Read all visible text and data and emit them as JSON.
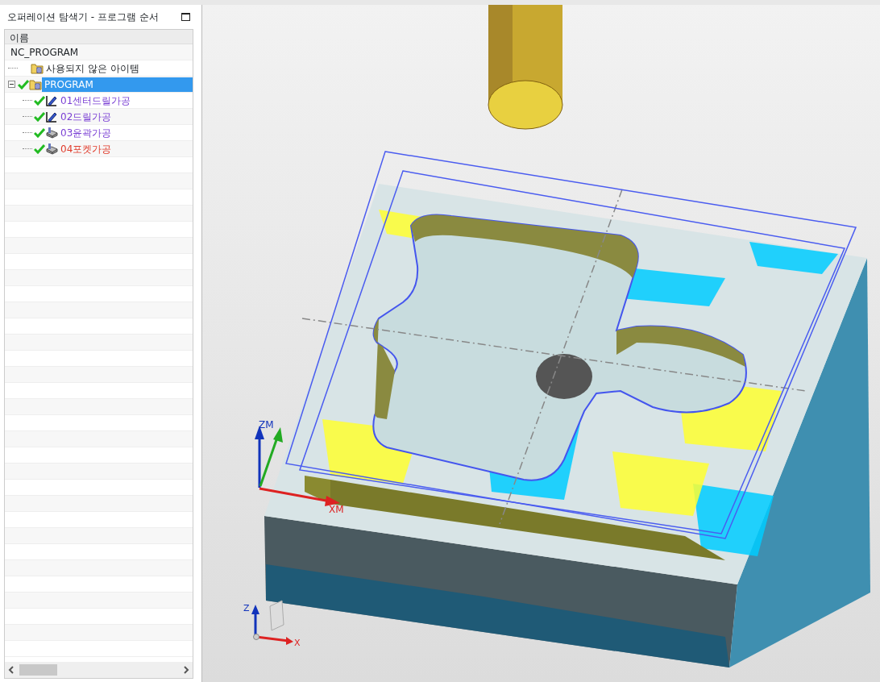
{
  "panel": {
    "title": "오퍼레이션 탐색기 - 프로그램 순서",
    "column": "이름"
  },
  "tree": {
    "label": "NC_PROGRAM",
    "children": [
      {
        "label": "사용되지 않은 아이템",
        "kind": "folder",
        "done": false,
        "selected": false
      },
      {
        "label": "PROGRAM",
        "kind": "folder",
        "done": true,
        "selected": true,
        "expanded": true,
        "children": [
          {
            "label": "01센터드릴가공",
            "kind": "drill",
            "done": true,
            "selected": false,
            "color": "#7a3fd4"
          },
          {
            "label": "02드릴가공",
            "kind": "drill",
            "done": true,
            "selected": false,
            "color": "#7a3fd4"
          },
          {
            "label": "03윤곽가공",
            "kind": "mill",
            "done": true,
            "selected": false,
            "color": "#7a3fd4"
          },
          {
            "label": "04포켓가공",
            "kind": "mill",
            "done": true,
            "selected": false,
            "color": "#e03a2a"
          }
        ]
      }
    ]
  },
  "viewport": {
    "wcs_labels": [
      "ZM",
      "XM"
    ],
    "triad_labels": [
      "Z",
      "X"
    ]
  }
}
